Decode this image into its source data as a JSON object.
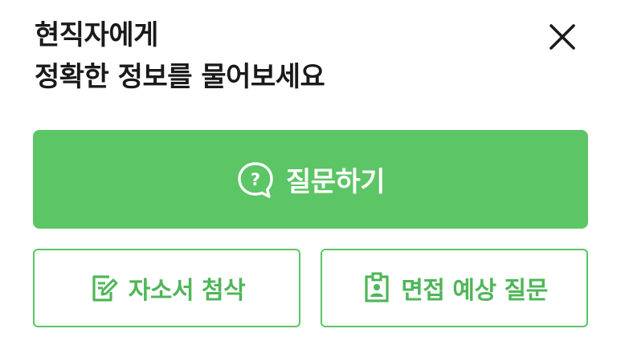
{
  "header": {
    "title_line1": "현직자에게",
    "title_line2": "정확한 정보를 물어보세요"
  },
  "icons": {
    "close": "close-icon",
    "question": "question-bubble-icon",
    "edit_document": "edit-document-icon",
    "id_badge": "id-badge-icon"
  },
  "actions": {
    "ask_label": "질문하기",
    "resume_review_label": "자소서 첨삭",
    "interview_questions_label": "면접 예상 질문"
  },
  "colors": {
    "accent": "#5cc565",
    "accent_text": "#4fb659",
    "title_text": "#1a1a1a"
  }
}
